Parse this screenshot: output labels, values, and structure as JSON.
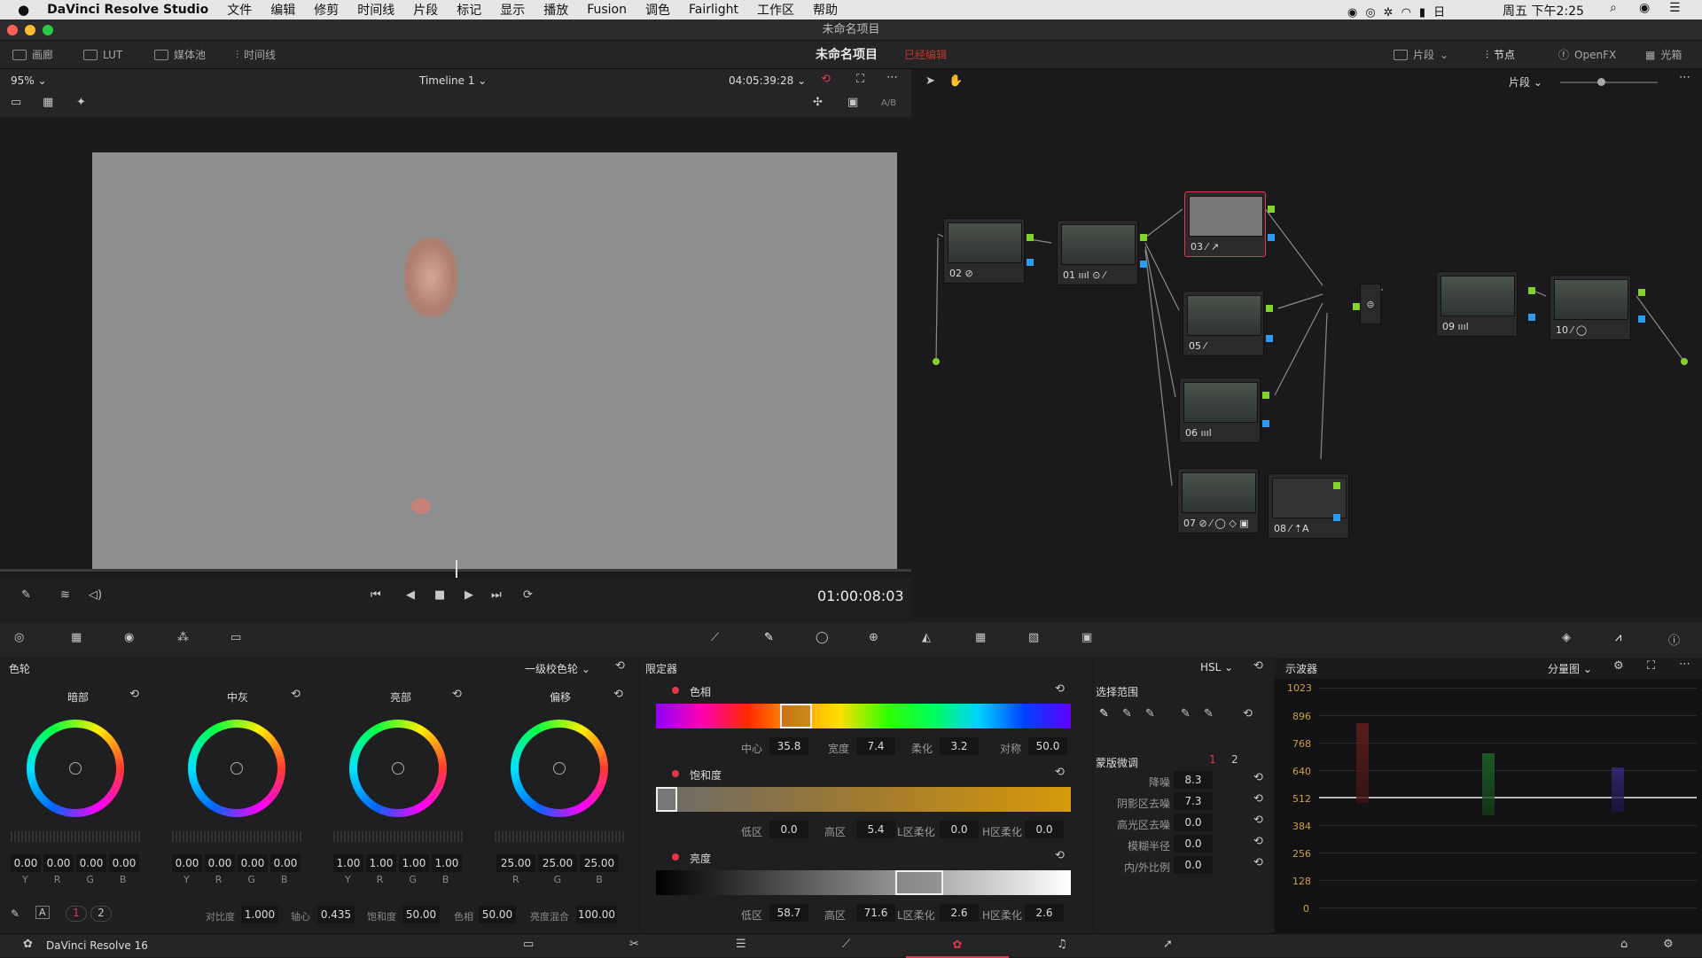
{
  "menubar": {
    "app": "DaVinci Resolve Studio",
    "items": [
      "文件",
      "编辑",
      "修剪",
      "时间线",
      "片段",
      "标记",
      "显示",
      "播放",
      "Fusion",
      "调色",
      "Fairlight",
      "工作区",
      "帮助"
    ],
    "clock": "周五 下午2:25"
  },
  "window": {
    "title": "未命名项目"
  },
  "toolbar": {
    "gallery": "画廊",
    "lut": "LUT",
    "media_pool": "媒体池",
    "timeline": "时间线",
    "project": "未命名项目",
    "status": "已经编辑",
    "clips": "片段",
    "nodes": "节点",
    "openfx": "OpenFX",
    "lightbox": "光箱"
  },
  "viewer": {
    "zoom": "95%",
    "timeline_name": "Timeline 1",
    "timecode_top": "04:05:39:28",
    "timecode": "01:00:08:03",
    "ab": "A/B",
    "playhead_fraction": 0.5
  },
  "nodegraph": {
    "mode": "片段",
    "nodes": [
      {
        "label": "02 ⊘"
      },
      {
        "label": "01 ıııl ⊙ ⁄"
      },
      {
        "label": "03 ⁄ ↗"
      },
      {
        "label": "05 ⁄"
      },
      {
        "label": "06 ıııl"
      },
      {
        "label": "07 ⊘ ⁄ ◯ ◇ ▣"
      },
      {
        "label": "08 ⁄ ⇡A"
      },
      {
        "label": "09 ıııl"
      },
      {
        "label": "10 ⁄ ◯"
      }
    ]
  },
  "colorwheels": {
    "title": "色轮",
    "mode": "一级校色轮",
    "wheels": [
      {
        "name": "暗部",
        "values": [
          "0.00",
          "0.00",
          "0.00",
          "0.00"
        ],
        "channels": [
          "Y",
          "R",
          "G",
          "B"
        ]
      },
      {
        "name": "中灰",
        "values": [
          "0.00",
          "0.00",
          "0.00",
          "0.00"
        ],
        "channels": [
          "Y",
          "R",
          "G",
          "B"
        ]
      },
      {
        "name": "亮部",
        "values": [
          "1.00",
          "1.00",
          "1.00",
          "1.00"
        ],
        "channels": [
          "Y",
          "R",
          "G",
          "B"
        ]
      },
      {
        "name": "偏移",
        "values": [
          "25.00",
          "25.00",
          "25.00"
        ],
        "channels": [
          "R",
          "G",
          "B"
        ]
      }
    ],
    "footer": {
      "page1": "1",
      "page2": "2",
      "contrast_label": "对比度",
      "contrast": "1.000",
      "pivot_label": "轴心",
      "pivot": "0.435",
      "sat_label": "饱和度",
      "sat": "50.00",
      "hue_label": "色相",
      "hue": "50.00",
      "lummix_label": "亮度混合",
      "lummix": "100.00"
    }
  },
  "qualifier": {
    "title": "限定器",
    "mode": "HSL",
    "hue": {
      "label": "色相",
      "center_label": "中心",
      "center": "35.8",
      "width_label": "宽度",
      "width": "7.4",
      "soft_label": "柔化",
      "soft": "3.2",
      "sym_label": "对称",
      "sym": "50.0"
    },
    "sat": {
      "label": "饱和度",
      "low_label": "低区",
      "low": "0.0",
      "high_label": "高区",
      "high": "5.4",
      "lsoft_label": "L区柔化",
      "lsoft": "0.0",
      "hsoft_label": "H区柔化",
      "hsoft": "0.0"
    },
    "lum": {
      "label": "亮度",
      "low_label": "低区",
      "low": "58.7",
      "high_label": "高区",
      "high": "71.6",
      "lsoft_label": "L区柔化",
      "lsoft": "2.6",
      "hsoft_label": "H区柔化",
      "hsoft": "2.6"
    }
  },
  "selection": {
    "title": "选择范围",
    "matte_title": "蒙版微调",
    "p1": "1",
    "p2": "2",
    "rows": [
      {
        "label": "降噪",
        "value": "8.3"
      },
      {
        "label": "阴影区去噪",
        "value": "7.3"
      },
      {
        "label": "高光区去噪",
        "value": "0.0"
      },
      {
        "label": "模糊半径",
        "value": "0.0"
      },
      {
        "label": "内/外比例",
        "value": "0.0"
      }
    ]
  },
  "scope": {
    "title": "示波器",
    "mode": "分量图",
    "ticks": [
      "1023",
      "896",
      "768",
      "640",
      "512",
      "384",
      "256",
      "128",
      "0"
    ]
  },
  "footer": {
    "app": "DaVinci Resolve 16"
  },
  "colors": {
    "accent": "#e2384d",
    "node_green": "#86d132",
    "node_blue": "#2d9cf0"
  }
}
